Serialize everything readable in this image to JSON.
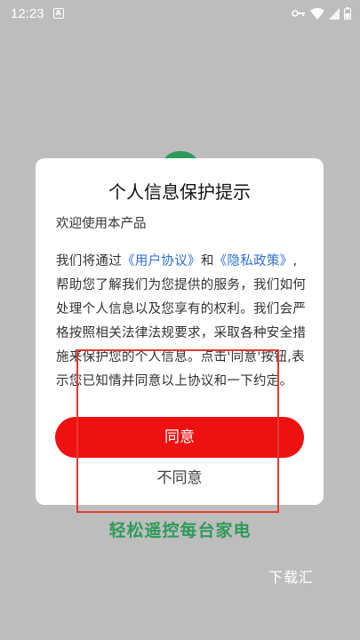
{
  "status_bar": {
    "time": "12:23",
    "notification_icon": "a-icon",
    "icons": [
      "key-icon",
      "wifi-icon",
      "signal-icon",
      "battery-icon"
    ]
  },
  "dialog": {
    "title": "个人信息保护提示",
    "welcome": "欢迎使用本产品",
    "body": {
      "part1": "我们将通过",
      "user_agreement": "《用户协议》",
      "and": "和",
      "privacy_policy": "《隐私政策》",
      "part2": ",帮助您了解我们为您提供的服务，我们如何处理个人信息以及您享有的权利。我们会严格按照相关法律法规要求，采取各种安全措施来保护您的个人信息。点击'同意'按钮,表示您已知情并同意以上协议和一下约定。"
    },
    "agree_label": "同意",
    "disagree_label": "不同意"
  },
  "slogan": "轻松遥控每台家电",
  "watermark": "下载汇",
  "colors": {
    "agree_button": "#ee1111",
    "link": "#2f6fd1",
    "slogan": "#2e9b5a",
    "highlight": "#e53935"
  }
}
